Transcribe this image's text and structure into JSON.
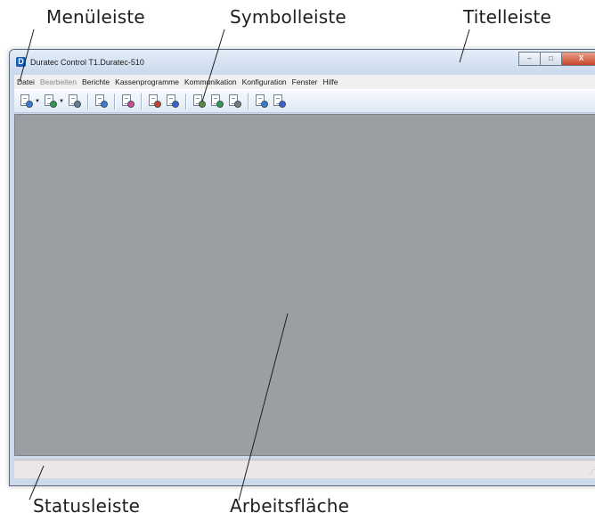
{
  "callouts": {
    "menu_bar": "Menüleiste",
    "toolbar": "Symbolleiste",
    "title_bar": "Titelleiste",
    "status_bar": "Statusleiste",
    "workspace": "Arbeitsfläche"
  },
  "window": {
    "logo": "D",
    "title": "Duratec Control T1.Duratec-510",
    "buttons": {
      "minimize": "–",
      "maximize": "□",
      "close": "X"
    }
  },
  "menu": [
    {
      "label": "Datei",
      "enabled": true
    },
    {
      "label": "Bearbeiten",
      "enabled": false
    },
    {
      "label": "Berichte",
      "enabled": true
    },
    {
      "label": "Kassenprogramme",
      "enabled": true
    },
    {
      "label": "Kommunikation",
      "enabled": true
    },
    {
      "label": "Konfiguration",
      "enabled": true
    },
    {
      "label": "Fenster",
      "enabled": true
    },
    {
      "label": "Hilfe",
      "enabled": true
    }
  ],
  "toolbar_icons": [
    {
      "name": "new-doc-icon",
      "badge": "#3a7bd5",
      "dropdown": true
    },
    {
      "name": "open-doc-icon",
      "badge": "#2e9a4a",
      "dropdown": true
    },
    {
      "name": "calc-icon",
      "badge": "#6a7a90",
      "dropdown": false
    },
    {
      "sep": true
    },
    {
      "name": "calendar-icon",
      "badge": "#3a7bd5",
      "dropdown": false
    },
    {
      "sep": true
    },
    {
      "name": "edit-icon",
      "badge": "#d04a9a",
      "dropdown": false
    },
    {
      "sep": true
    },
    {
      "name": "send-icon",
      "badge": "#d33b2c",
      "dropdown": false
    },
    {
      "name": "receive-icon",
      "badge": "#3a5fd5",
      "dropdown": false
    },
    {
      "sep": true
    },
    {
      "name": "report-icon",
      "badge": "#5a8a3a",
      "dropdown": false
    },
    {
      "name": "transfer-icon",
      "badge": "#2e9a4a",
      "dropdown": false
    },
    {
      "name": "settings-icon",
      "badge": "#7a7a7a",
      "dropdown": false
    },
    {
      "sep": true
    },
    {
      "name": "print-icon",
      "badge": "#3a7bd5",
      "dropdown": false
    },
    {
      "name": "signal-icon",
      "badge": "#3a5fd5",
      "dropdown": false
    }
  ],
  "statusbar": {
    "text": ""
  }
}
